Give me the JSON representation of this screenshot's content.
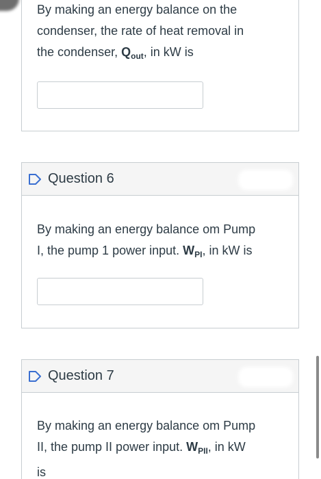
{
  "q5": {
    "text_line1": "By making an energy balance on the",
    "text_line2": "condenser, the rate of heat removal in",
    "text_line3_pre": "the condenser, ",
    "text_line3_var": "Q",
    "text_line3_sub": "out",
    "text_line3_post": ", in kW is",
    "input_value": ""
  },
  "q6": {
    "title": "Question 6",
    "text_line1": "By making an energy balance om Pump",
    "text_line2_pre": "I, the pump 1 power input. ",
    "text_line2_var": "W",
    "text_line2_sub": "PI",
    "text_line2_post": ", in kW is",
    "input_value": ""
  },
  "q7": {
    "title": "Question 7",
    "text_line1": "By making an energy balance om Pump",
    "text_line2_pre": "II, the pump II power input. ",
    "text_line2_var": "W",
    "text_line2_sub": "PII",
    "text_line2_post": ", in kW",
    "text_line3": "is"
  },
  "icons": {
    "flag": "flag-outline-icon"
  },
  "colors": {
    "border": "#c7cdd1",
    "header_bg": "#f5f5f5",
    "text": "#2d3b45"
  }
}
